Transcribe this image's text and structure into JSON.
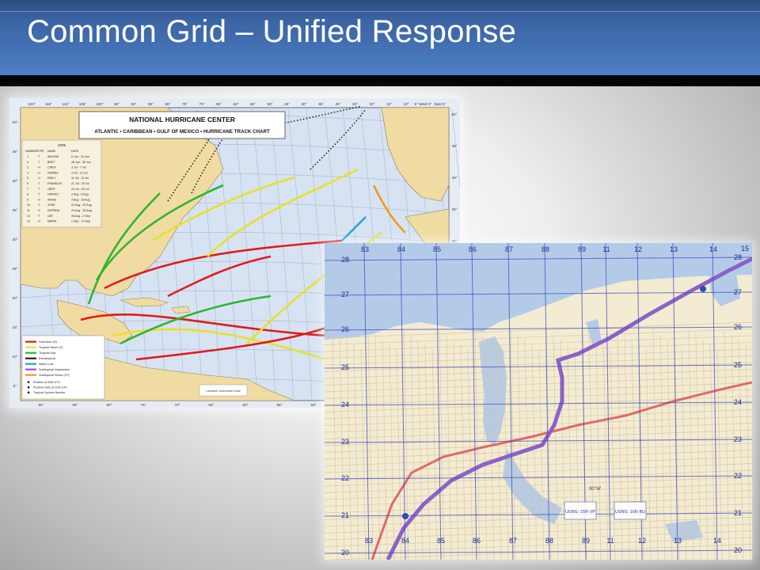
{
  "slide": {
    "title": "Common Grid – Unified Response"
  },
  "hurricane_chart": {
    "header_line1": "NATIONAL HURRICANE CENTER",
    "header_line2": "ATLANTIC • CARIBBEAN • GULF OF MEXICO • HURRICANE TRACK CHART",
    "year": "2005",
    "table_headers": [
      "NUMBER",
      "TYPE",
      "NAME",
      "DATE"
    ],
    "storms": [
      {
        "number": "1",
        "type": "T",
        "name": "ARLENE",
        "date": "8 Jun - 13 Jun"
      },
      {
        "number": "2",
        "type": "T",
        "name": "BRET",
        "date": "28 Jun - 30 Jun"
      },
      {
        "number": "3",
        "type": "H",
        "name": "CINDY",
        "date": "3 Jul - 7 Jul"
      },
      {
        "number": "4",
        "type": "H",
        "name": "DENNIS",
        "date": "4 Jul - 13 Jul"
      },
      {
        "number": "5",
        "type": "H",
        "name": "EMILY",
        "date": "11 Jul - 21 Jul"
      },
      {
        "number": "6",
        "type": "T",
        "name": "FRANKLIN",
        "date": "21 Jul - 29 Jul"
      },
      {
        "number": "7",
        "type": "T",
        "name": "GERT",
        "date": "23 Jul - 25 Jul"
      },
      {
        "number": "8",
        "type": "T",
        "name": "HARVEY",
        "date": "2 Aug - 8 Aug"
      },
      {
        "number": "9",
        "type": "H",
        "name": "IRENE",
        "date": "4 Aug - 18 Aug"
      },
      {
        "number": "10",
        "type": "T",
        "name": "JOSE",
        "date": "22 Aug - 23 Aug"
      },
      {
        "number": "11",
        "type": "H",
        "name": "KATRINA",
        "date": "23 Aug - 30 Aug"
      },
      {
        "number": "12",
        "type": "T",
        "name": "LEE",
        "date": "28 Aug - 2 Sep"
      },
      {
        "number": "13",
        "type": "H",
        "name": "MARIA",
        "date": "1 Sep - 10 Sep"
      }
    ],
    "legend": [
      {
        "label": "Hurricane (H)",
        "color": "#e01b1b"
      },
      {
        "label": "Tropical Storm (T)",
        "color": "#e8e02a"
      },
      {
        "label": "Tropical Dep.",
        "color": "#2fb52f"
      },
      {
        "label": "Extratropical",
        "color": "#222222"
      },
      {
        "label": "Wave/ Low",
        "color": "#2aa0d6"
      },
      {
        "label": "Subtropical Depression",
        "color": "#9a52c4"
      },
      {
        "label": "Subtropical Storm (ST)",
        "color": "#f29a1e"
      }
    ],
    "legend_notes": [
      "Position at 0000 UTC",
      "Position/ date at 1200 UTC",
      "Tropical Cyclone Number"
    ],
    "top_longitudes": [
      "120°",
      "115°",
      "110°",
      "105°",
      "100°",
      "95°",
      "90°",
      "85°",
      "80°",
      "75°",
      "70°",
      "65°",
      "60°",
      "55°",
      "50°",
      "45°",
      "40°",
      "35°",
      "30°",
      "25°",
      "20°",
      "15°",
      "10°",
      "5° West 0°",
      "East 5°"
    ],
    "bottom_longitudes": [
      "90°",
      "85°",
      "80°",
      "75°",
      "70°",
      "65°",
      "60°",
      "55°",
      "50°",
      "45°"
    ],
    "left_latitudes": [
      "50°",
      "45°",
      "40°",
      "35°",
      "30°",
      "25°",
      "20°",
      "15°",
      "10°",
      "5°"
    ],
    "right_latitudes": [
      "50°",
      "45°",
      "40°",
      "35°",
      "30°"
    ],
    "credit": "Lambert Conformal Conic"
  },
  "grid_map": {
    "top_labels": [
      "83",
      "84",
      "85",
      "86",
      "87",
      "88",
      "89",
      "11",
      "12",
      "13",
      "14"
    ],
    "bottom_labels": [
      "83",
      "84",
      "85",
      "86",
      "87",
      "88",
      "89",
      "11",
      "12",
      "13",
      "14"
    ],
    "left_labels": [
      "28",
      "27",
      "26",
      "25",
      "24",
      "23",
      "22",
      "21",
      "20"
    ],
    "right_labels": [
      "28",
      "27",
      "26",
      "25",
      "24",
      "23",
      "22",
      "21",
      "20"
    ],
    "corner_label": "15",
    "usng_labels": [
      "USNG: 15R VP",
      "USNG: 16R BU"
    ],
    "meridian_label": "90°W",
    "colors": {
      "water": "#b4cbe8",
      "land": "#f3ecd2",
      "grid": "#3d4dc4",
      "highway": "#8a62c8",
      "rail": "#dd6a6a"
    }
  }
}
